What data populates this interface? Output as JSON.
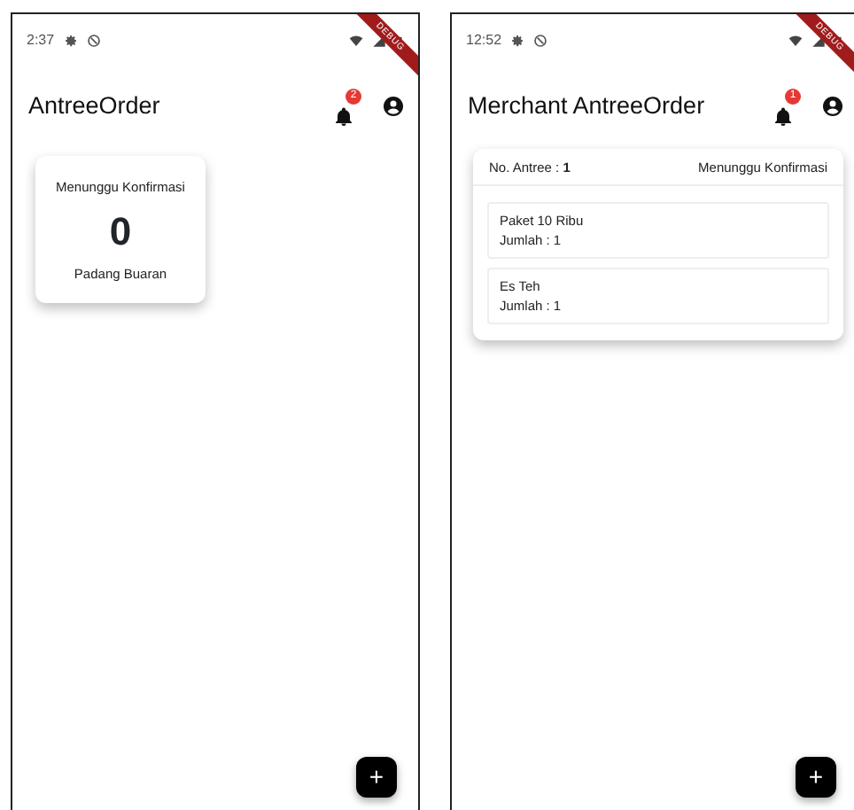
{
  "screens": [
    {
      "status_bar": {
        "time": "2:37"
      },
      "debug_banner": "DEBUG",
      "app_bar": {
        "title": "AntreeOrder",
        "notification_count": "2"
      },
      "summary_cards": [
        {
          "status": "Menunggu Konfirmasi",
          "count": "0",
          "location": "Padang Buaran"
        }
      ],
      "fab": "+"
    },
    {
      "status_bar": {
        "time": "12:52"
      },
      "debug_banner": "DEBUG",
      "app_bar": {
        "title": "Merchant AntreeOrder",
        "notification_count": "1"
      },
      "orders": [
        {
          "queue": "No. Antree : **1**",
          "status": "Menunggu Konfirmasi",
          "items": [
            {
              "name": "Paket 10 Ribu",
              "quantity": "Jumlah : 1"
            },
            {
              "name": "Es Teh",
              "quantity": "Jumlah : 1"
            }
          ]
        }
      ],
      "fab": "+"
    }
  ]
}
